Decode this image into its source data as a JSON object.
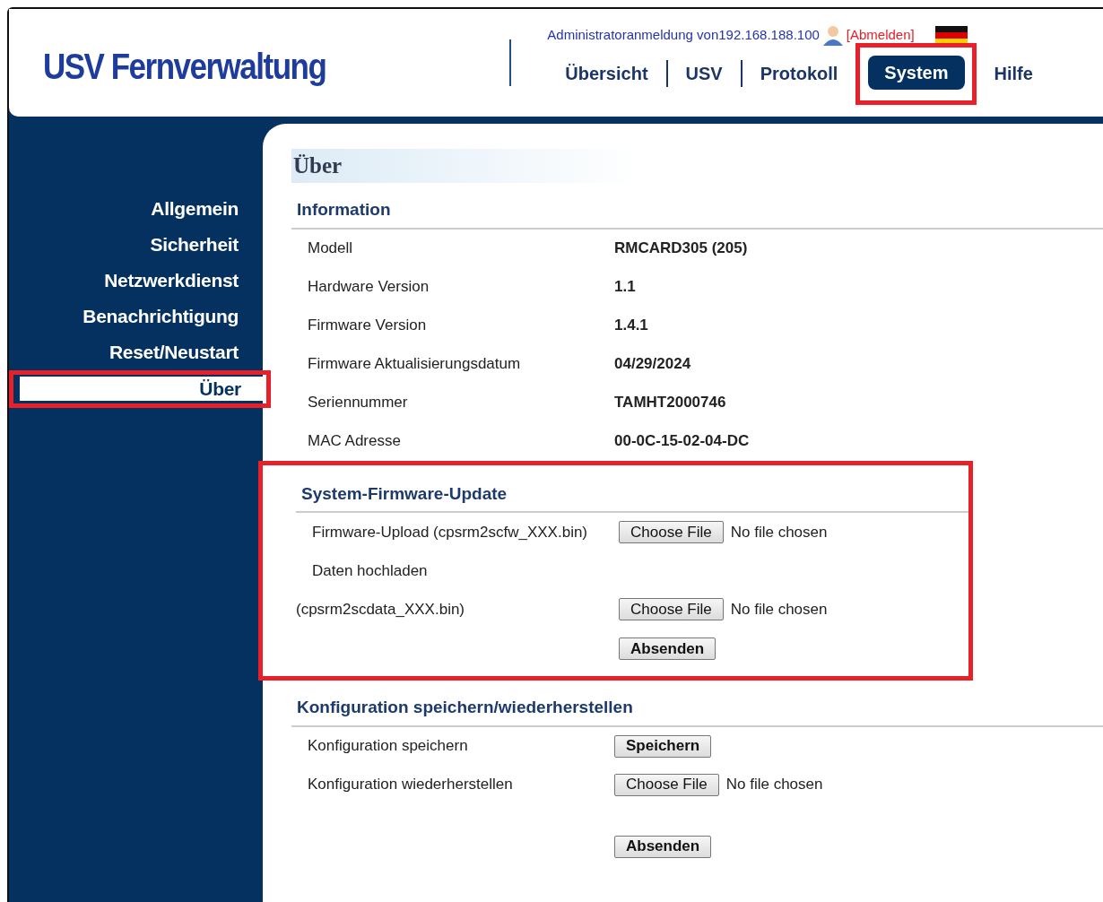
{
  "header": {
    "logo": "USV Fernverwaltung",
    "login_text": "Administratoranmeldung von192.168.188.100",
    "logout": "[Abmelden]",
    "nav": [
      {
        "label": "Übersicht",
        "selected": false,
        "highlighted": false
      },
      {
        "label": "USV",
        "selected": false,
        "highlighted": false
      },
      {
        "label": "Protokoll",
        "selected": false,
        "highlighted": false
      },
      {
        "label": "System",
        "selected": true,
        "highlighted": true
      },
      {
        "label": "Hilfe",
        "selected": false,
        "highlighted": false
      }
    ]
  },
  "sidebar": {
    "items": [
      {
        "label": "Allgemein",
        "selected": false,
        "highlighted": false
      },
      {
        "label": "Sicherheit",
        "selected": false,
        "highlighted": false
      },
      {
        "label": "Netzwerkdienst",
        "selected": false,
        "highlighted": false
      },
      {
        "label": "Benachrichtigung",
        "selected": false,
        "highlighted": false
      },
      {
        "label": "Reset/Neustart",
        "selected": false,
        "highlighted": false
      },
      {
        "label": "Über",
        "selected": true,
        "highlighted": true
      }
    ]
  },
  "page_title": "Über",
  "sections": [
    {
      "title": "Information",
      "highlighted": false,
      "rows": [
        {
          "kind": "info",
          "label": "Modell",
          "value": "RMCARD305 (205)"
        },
        {
          "kind": "info",
          "label": "Hardware Version",
          "value": "1.1"
        },
        {
          "kind": "info",
          "label": "Firmware Version",
          "value": "1.4.1"
        },
        {
          "kind": "info",
          "label": "Firmware Aktualisierungsdatum",
          "value": "04/29/2024"
        },
        {
          "kind": "info",
          "label": "Seriennummer",
          "value": "TAMHT2000746"
        },
        {
          "kind": "info",
          "label": "MAC Adresse",
          "value": "00-0C-15-02-04-DC"
        }
      ]
    },
    {
      "title": "System-Firmware-Update",
      "highlighted": true,
      "rows": [
        {
          "kind": "file",
          "label": "Firmware-Upload (cpsrm2scfw_XXX.bin)",
          "button": "Choose File",
          "status": "No file chosen"
        },
        {
          "kind": "note",
          "label": "Daten hochladen"
        },
        {
          "kind": "file-outdent",
          "label": "(cpsrm2scdata_XXX.bin)",
          "button": "Choose File",
          "status": "No file chosen"
        },
        {
          "kind": "submit",
          "button": "Absenden"
        }
      ]
    },
    {
      "title": "Konfiguration speichern/wiederherstellen",
      "highlighted": false,
      "rows": [
        {
          "kind": "action",
          "label": "Konfiguration speichern",
          "button": "Speichern"
        },
        {
          "kind": "file",
          "label": "Konfiguration wiederherstellen",
          "button": "Choose File",
          "status": "No file chosen"
        },
        {
          "kind": "submit",
          "button": "Absenden"
        }
      ]
    }
  ]
}
